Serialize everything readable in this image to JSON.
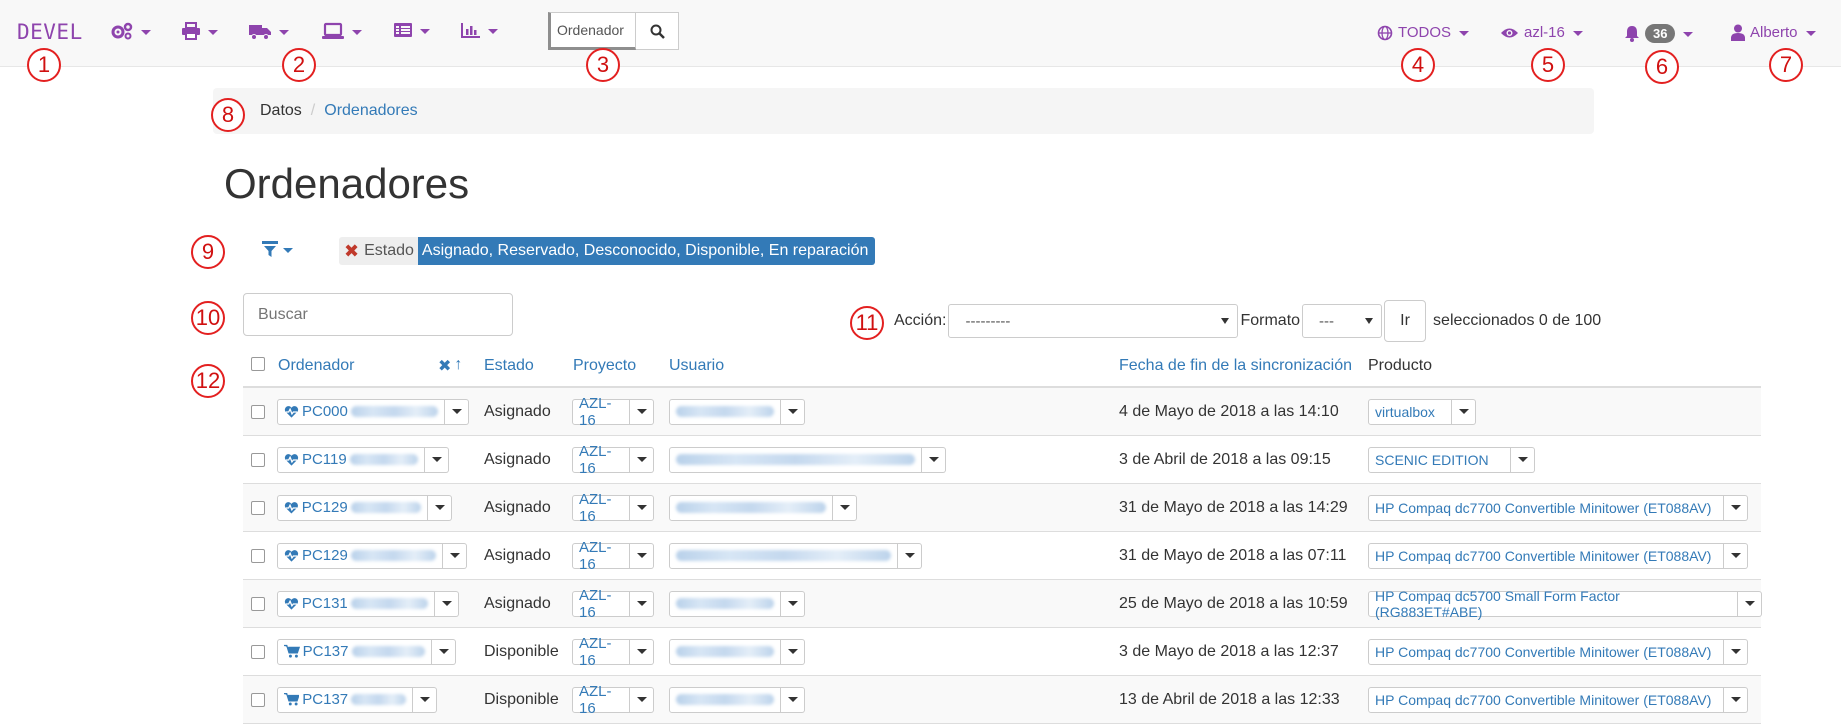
{
  "navbar": {
    "brand": "DEVEL",
    "search": {
      "value": "Ordenador",
      "placeholder": "Ordenador"
    },
    "lots_filter": "TODOS",
    "watch_label": "azl-16",
    "notifications_count": "36",
    "user_name": "Alberto",
    "icons": [
      "cogs-icon",
      "print-icon",
      "truck-icon",
      "laptop-icon",
      "list-icon",
      "bar-chart-icon",
      "search-icon",
      "globe-icon",
      "eye-icon",
      "bell-icon",
      "user-icon"
    ]
  },
  "markers": [
    "1",
    "2",
    "3",
    "4",
    "5",
    "6",
    "7",
    "8",
    "9",
    "10",
    "11",
    "12"
  ],
  "breadcrumb": {
    "root": "Datos",
    "separator": "/",
    "current": "Ordenadores"
  },
  "page_title": "Ordenadores",
  "filter": {
    "key": "Estado",
    "value": "Asignado, Reservado, Desconocido, Disponible, En reparación"
  },
  "search_box": {
    "placeholder": "Buscar"
  },
  "actions": {
    "action_label": "Acción:",
    "action_value": "---------",
    "format_label": "Formato",
    "format_value": "---",
    "go_label": "Ir",
    "selected_text": "seleccionados 0 de 100"
  },
  "table": {
    "headers": {
      "computer": "Ordenador",
      "status": "Estado",
      "project": "Proyecto",
      "user": "Usuario",
      "sync_end": "Fecha de fin de la sincronización",
      "product": "Producto"
    },
    "rows": [
      {
        "icon": "heartbeat-icon",
        "computer": "PC000",
        "status": "Asignado",
        "project": "AZL-16",
        "sync_end": "4 de Mayo de 2018 a las 14:10",
        "product": "virtualbox"
      },
      {
        "icon": "heartbeat-icon",
        "computer": "PC119",
        "status": "Asignado",
        "project": "AZL-16",
        "sync_end": "3 de Abril de 2018 a las 09:15",
        "product": "SCENIC EDITION"
      },
      {
        "icon": "heartbeat-icon",
        "computer": "PC129",
        "status": "Asignado",
        "project": "AZL-16",
        "sync_end": "31 de Mayo de 2018 a las 14:29",
        "product": "HP Compaq dc7700 Convertible Minitower (ET088AV)"
      },
      {
        "icon": "heartbeat-icon",
        "computer": "PC129",
        "status": "Asignado",
        "project": "AZL-16",
        "sync_end": "31 de Mayo de 2018 a las 07:11",
        "product": "HP Compaq dc7700 Convertible Minitower (ET088AV)"
      },
      {
        "icon": "heartbeat-icon",
        "computer": "PC131",
        "status": "Asignado",
        "project": "AZL-16",
        "sync_end": "25 de Mayo de 2018 a las 10:59",
        "product": "HP Compaq dc5700 Small Form Factor (RG883ET#ABE)"
      },
      {
        "icon": "shopping-cart-icon",
        "computer": "PC137",
        "status": "Disponible",
        "project": "AZL-16",
        "sync_end": "3 de Mayo de 2018 a las 12:37",
        "product": "HP Compaq dc7700 Convertible Minitower (ET088AV)"
      },
      {
        "icon": "shopping-cart-icon",
        "computer": "PC137",
        "status": "Disponible",
        "project": "AZL-16",
        "sync_end": "13 de Abril de 2018 a las 12:33",
        "product": "HP Compaq dc7700 Convertible Minitower (ET088AV)"
      }
    ]
  },
  "colors": {
    "brand": "#8e44ad",
    "link": "#337ab7",
    "marker": "#e32020",
    "chip": "#337ab7"
  }
}
